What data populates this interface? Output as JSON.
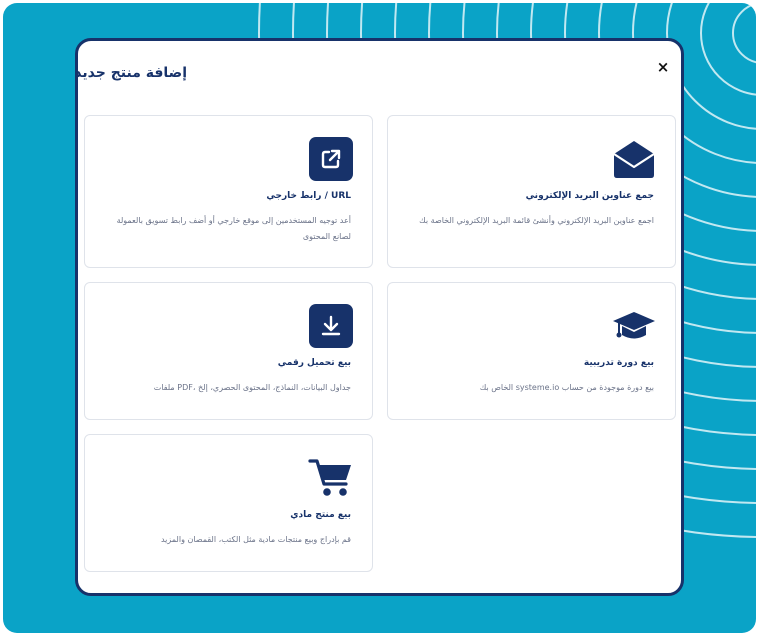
{
  "colors": {
    "background": "#0aa3c7",
    "navy": "#17326a",
    "card_border": "#dfe3ea",
    "muted_text": "#6b7389"
  },
  "modal": {
    "title": "إضافة منتج جديد",
    "close_glyph": "×"
  },
  "cards": [
    {
      "icon": "envelope-icon",
      "title": "جمع عناوين البريد الإلكتروني",
      "description": "اجمع عناوين البريد الإلكتروني وأنشئ قائمة البريد الإلكتروني الخاصة بك"
    },
    {
      "icon": "external-link-icon",
      "title": "URL / رابط خارجي",
      "description": "أعد توجيه المستخدمين إلى موقع خارجي أو أضف رابط تسويق بالعمولة لصانع المحتوى"
    },
    {
      "icon": "graduation-cap-icon",
      "title": "بيع دورة تدريبية",
      "description": "بيع دورة موجودة من حساب systeme.io الخاص بك"
    },
    {
      "icon": "download-icon",
      "title": "بيع تحميل رقمي",
      "description": "جداول البيانات، النماذج، المحتوى الحصري، إلخ ،PDF ملفات"
    },
    {
      "icon": "shopping-cart-icon",
      "title": "بيع منتج مادي",
      "description": "قم بإدراج وبيع منتجات مادية مثل الكتب، القمصان والمزيد"
    }
  ]
}
